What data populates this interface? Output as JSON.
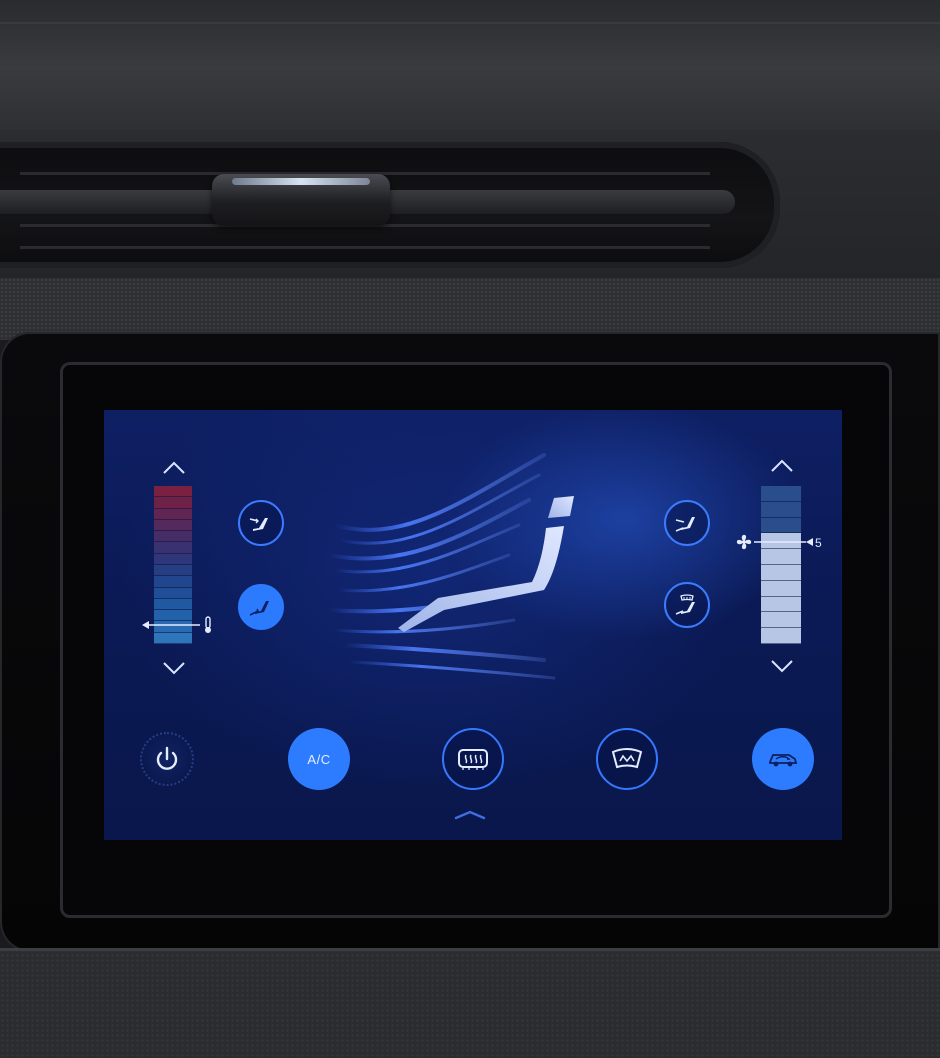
{
  "climate": {
    "fan_level": "5",
    "temperature_level": 0.2,
    "fan_speed_level": 0.7,
    "temperature_scale": {
      "segments": 14,
      "colors": [
        "#7a2040",
        "#6e2248",
        "#612552",
        "#54295c",
        "#472d66",
        "#3a3170",
        "#2f377a",
        "#263e84",
        "#22468e",
        "#204f98",
        "#2058a2",
        "#2361ab",
        "#296bb3",
        "#2f75ba"
      ]
    },
    "fan_scale": {
      "segments": 10,
      "dim_color": "#2a4d8c",
      "lit_color": "#b6c6e4"
    }
  },
  "buttons": {
    "ac_label": "A/C"
  },
  "colors": {
    "accent": "#2c7bff",
    "accent_outline": "#3478ff",
    "icon_light": "#e4ecff"
  },
  "icons": {
    "temp_up": "chevron-up-icon",
    "temp_down": "chevron-down-icon",
    "fan_up": "chevron-up-icon",
    "fan_down": "chevron-down-icon",
    "thermometer": "thermometer-icon",
    "fan": "fan-icon",
    "power": "power-icon",
    "front_defrost": "front-defrost-icon",
    "rear_defrost": "rear-defrost-icon",
    "recirculation": "recirculation-icon",
    "mode_face": "airflow-face-icon",
    "mode_feet": "airflow-feet-icon",
    "mode_face_feet": "airflow-face-feet-icon",
    "mode_defrost_feet": "airflow-defrost-feet-icon",
    "panel_handle": "chevron-up-icon"
  }
}
